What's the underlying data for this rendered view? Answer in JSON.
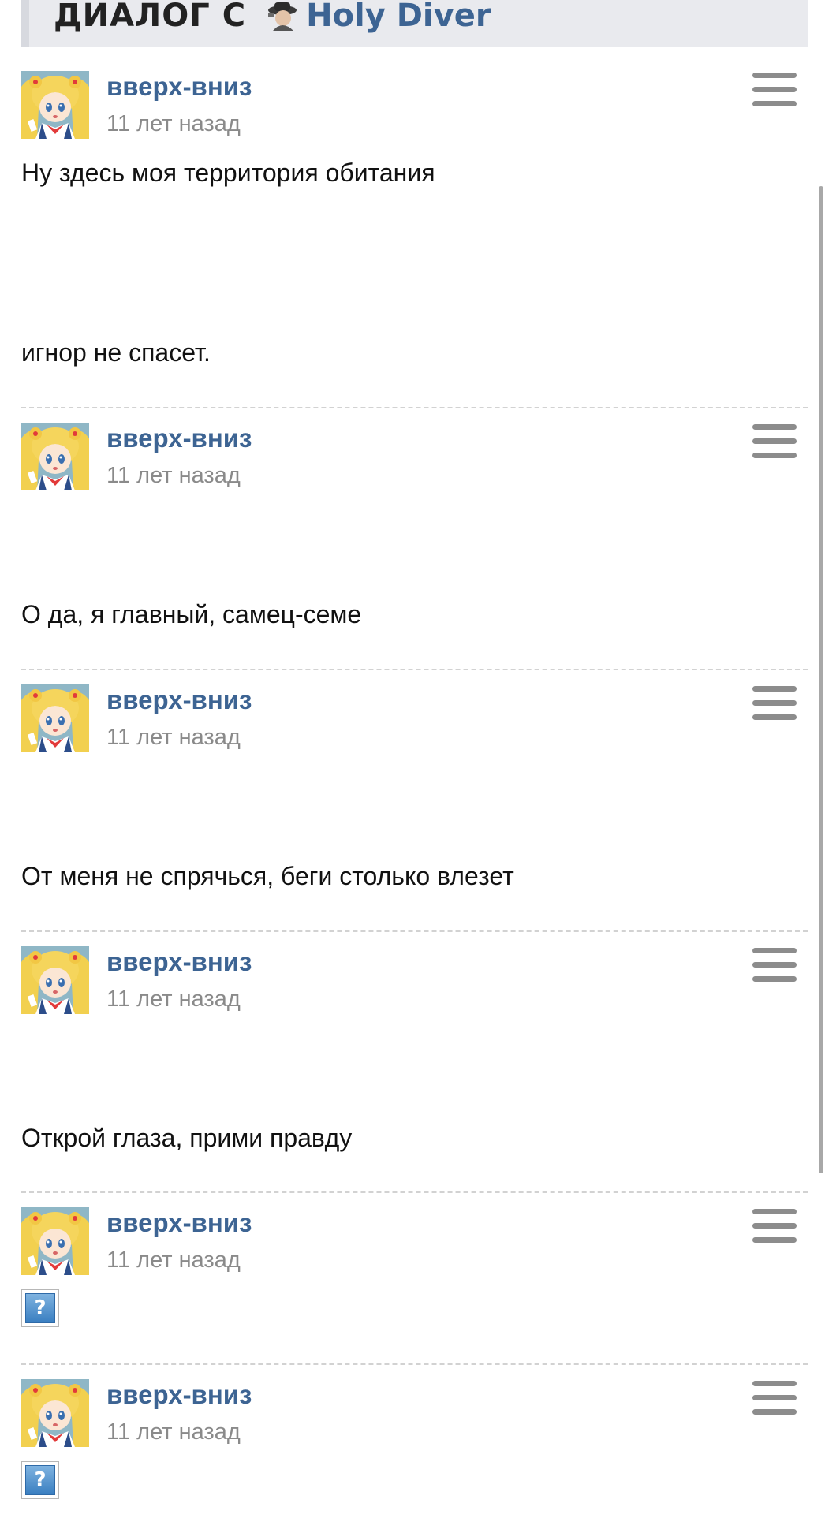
{
  "header": {
    "title": "ДИАЛОГ С",
    "user_name": "Holy Diver",
    "user_avatar_icon": "user-avatar-icon"
  },
  "colors": {
    "link": "#3d6493",
    "timestamp": "#8a8a8a",
    "header_bg": "#e9eaee",
    "menu_icon": "#8c8c8c"
  },
  "posts": [
    {
      "author": "вверх-вниз",
      "time": "11 лет назад",
      "line1": "Ну здесь моя территория обитания",
      "line2": "игнор не спасет."
    },
    {
      "author": "вверх-вниз",
      "time": "11 лет назад",
      "text": "О да, я главный, самец-семе"
    },
    {
      "author": "вверх-вниз",
      "time": "11 лет назад",
      "text": "От меня не спрячься, беги столько влезет"
    },
    {
      "author": "вверх-вниз",
      "time": "11 лет назад",
      "text": "Открой глаза, прими правду"
    },
    {
      "author": "вверх-вниз",
      "time": "11 лет назад",
      "image": "broken-image-icon",
      "image_glyph": "?"
    },
    {
      "author": "вверх-вниз",
      "time": "11 лет назад",
      "image": "broken-image-icon",
      "image_glyph": "?"
    }
  ]
}
